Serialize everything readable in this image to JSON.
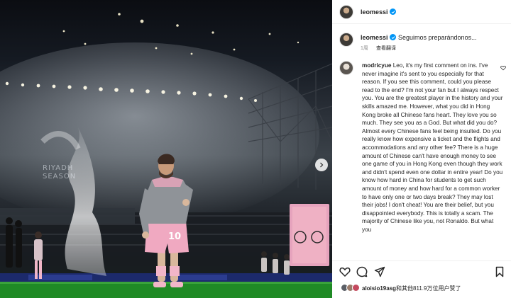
{
  "photo": {
    "alt_marks": "riyadh-season-stadium",
    "watermark_text": "RIYADH SEASON",
    "jersey_number": "10"
  },
  "header": {
    "username": "leomessi"
  },
  "caption": {
    "username": "leomessi",
    "text": "Seguimos preparándonos...",
    "age": "1周",
    "translate_label": "查看翻译"
  },
  "comment": {
    "username": "modricyue",
    "text": "Leo, it's my first comment on ins. I've never imagine it's sent to you especially for that reason. If you see this comment, could you please read to the end? I'm not your fan but I always respect you. You are the greatest player in the history and your skills amazed me. However, what you did in Hong Kong broke all Chinese fans heart. They love you so much. They see you as a God. But what did you do? Almost every Chinese fans feel being insulted. Do you really know how expensive a ticket and the flights and accommodations and any other fee? There is a huge amount of Chinese can't have enough money to see one game of you in Hong Kong even though they work and didn't spend even one dollar in entire year! Do you know how hard in China for students to get such amount of money and how hard for a common worker to have only one or two days break? They may lost their jobs! I don't cheat! You are their belief, but you disappointed everybody. This is totally a scam. The majority of Chinese like you, not Ronaldo. But what you"
  },
  "actions": {
    "like_icon": "heart-icon",
    "comment_icon": "comment-icon",
    "share_icon": "send-icon",
    "save_icon": "bookmark-icon"
  },
  "likes": {
    "user": "aloisio19asg",
    "suffix": "和其他811.9万位用户赞了"
  },
  "colors": {
    "verified": "#0095f6",
    "pitch": "#1d7a22",
    "jersey_pink": "#f2b6c8"
  }
}
